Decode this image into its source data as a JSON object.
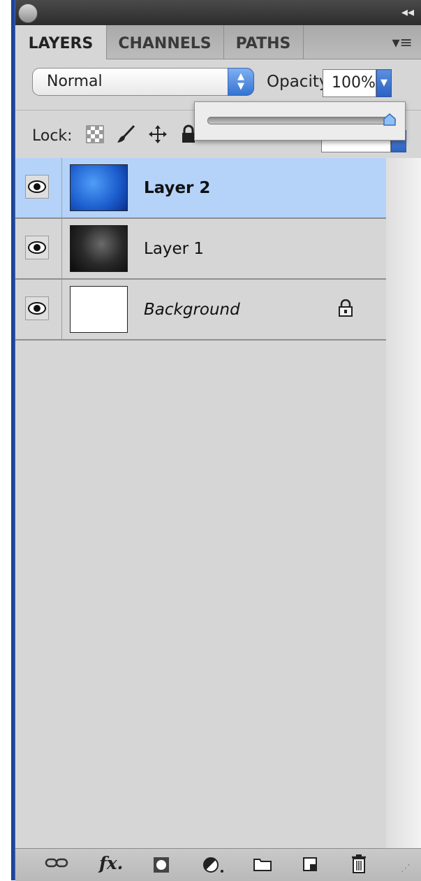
{
  "panel": {
    "tabs": [
      {
        "label": "LAYERS",
        "active": true
      },
      {
        "label": "CHANNELS",
        "active": false
      },
      {
        "label": "PATHS",
        "active": false
      }
    ],
    "collapse_icon": "double-chevron-right-icon",
    "menu_icon": "panel-menu-icon"
  },
  "blend": {
    "mode": "Normal",
    "opacity_label": "Opacity:",
    "opacity_value": "100%",
    "opacity_slider_level": 1.0
  },
  "lock": {
    "label": "Lock:",
    "icons": [
      "lock-transparency-icon",
      "lock-paint-brush-icon",
      "lock-position-move-icon",
      "lock-all-icon"
    ]
  },
  "layers": [
    {
      "name": "Layer 2",
      "visible": true,
      "selected": true,
      "locked": false,
      "thumbnail": "blue-sky-thumbnail"
    },
    {
      "name": "Layer 1",
      "visible": true,
      "selected": false,
      "locked": false,
      "thumbnail": "dark-photo-thumbnail"
    },
    {
      "name": "Background",
      "visible": true,
      "selected": false,
      "locked": true,
      "thumbnail": "white-thumbnail"
    }
  ],
  "bottom_toolbar": [
    "link-layers-icon",
    "fx-layer-style-icon",
    "add-mask-icon",
    "adjustment-layer-icon",
    "new-group-folder-icon",
    "new-layer-icon",
    "trash-icon"
  ],
  "colors": {
    "selected_row": "#b5d3f9",
    "panel_bg": "#d6d6d6",
    "accent_blue": "#3473d3"
  }
}
